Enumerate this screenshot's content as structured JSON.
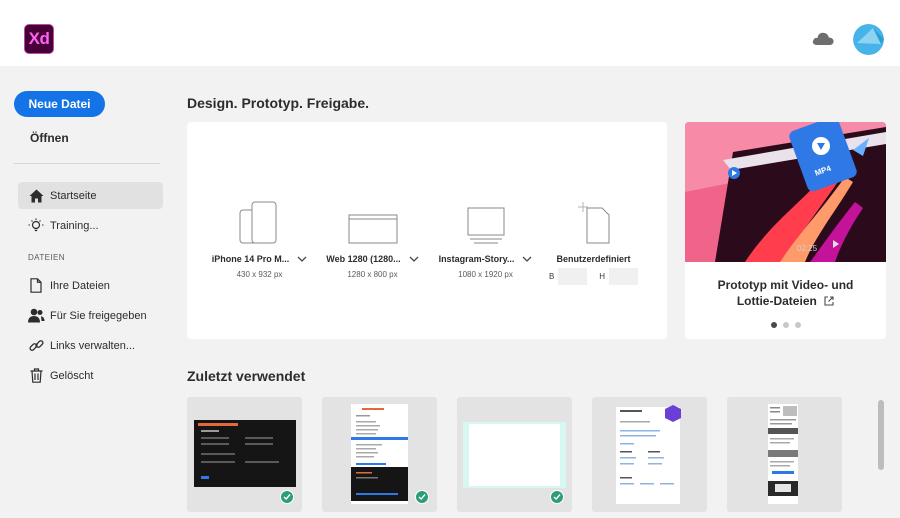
{
  "app": {
    "logo_text": "Xd",
    "accent_color": "#1473e6",
    "logo_bg": "#470137",
    "logo_fg": "#ff61f6"
  },
  "header": {
    "cloud_icon": "cloud-icon",
    "avatar_icon": "user-avatar"
  },
  "sidebar": {
    "new_file_label": "Neue Datei",
    "open_label": "Öffnen",
    "items": [
      {
        "label": "Startseite",
        "icon": "home-icon",
        "active": true
      },
      {
        "label": "Training...",
        "icon": "lightbulb-icon",
        "active": false
      }
    ],
    "files_section_label": "DATEIEN",
    "file_items": [
      {
        "label": "Ihre Dateien",
        "icon": "document-icon"
      },
      {
        "label": "Für Sie freigegeben",
        "icon": "shared-user-icon"
      },
      {
        "label": "Links verwalten...",
        "icon": "link-icon"
      },
      {
        "label": "Gelöscht",
        "icon": "trash-icon"
      }
    ]
  },
  "main": {
    "title": "Design. Prototyp. Freigabe.",
    "presets": [
      {
        "name": "iPhone 14 Pro M...",
        "size": "430 x 932 px",
        "icon": "phone-artboard-icon"
      },
      {
        "name": "Web 1280 (1280...",
        "size": "1280 x 800 px",
        "icon": "web-artboard-icon"
      },
      {
        "name": "Instagram-Story...",
        "size": "1080 x 1920 px",
        "icon": "monitor-artboard-icon"
      },
      {
        "name": "Benutzerdefiniert",
        "width_label": "B",
        "height_label": "H",
        "icon": "custom-artboard-icon"
      }
    ],
    "promo": {
      "title_line1": "Prototyp mit Video- und",
      "title_line2": "Lottie-Dateien",
      "badge_text": "MP4",
      "video_time": "02:25",
      "slide_count": 3,
      "active_slide": 1
    },
    "recent_title": "Zuletzt verwendet",
    "recent_files": [
      {
        "thumb": "dark-form-design",
        "synced": true
      },
      {
        "thumb": "orange-mobile-form",
        "synced": true
      },
      {
        "thumb": "blank-artboard",
        "synced": true
      },
      {
        "thumb": "purple-form-page",
        "synced": false
      },
      {
        "thumb": "gray-mobile-page",
        "synced": false
      }
    ]
  }
}
